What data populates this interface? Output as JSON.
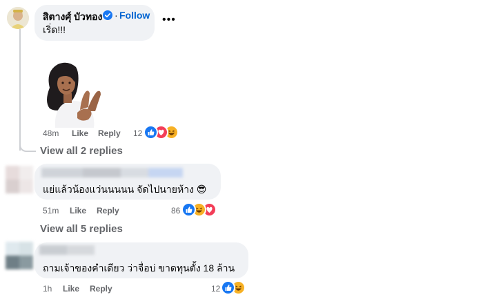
{
  "comment1": {
    "author": "สิตางศุ์ บัวทอง",
    "verified": true,
    "follow_label": "Follow",
    "text": "เริ่ด!!!",
    "more_icon": "more-options-icon",
    "time": "48m",
    "like_label": "Like",
    "reply_label": "Reply",
    "reaction_count": "12",
    "reactions": [
      "like",
      "love",
      "haha"
    ],
    "view_replies": "View all 2 replies"
  },
  "comment2": {
    "author_blurred": true,
    "text": "แย่แล้วน้องแว่นนนนน จัดไปนายห้าง 😎",
    "time": "51m",
    "like_label": "Like",
    "reply_label": "Reply",
    "reaction_count": "86",
    "reactions": [
      "like",
      "haha",
      "love"
    ],
    "view_replies": "View all 5 replies"
  },
  "comment3": {
    "author_blurred": true,
    "text": "ถามเจ้าของคำเดียว ว่าจื่อบ่ ขาดทุนตั้ง 18 ล้าน",
    "time": "1h",
    "like_label": "Like",
    "reply_label": "Reply",
    "reaction_count": "12",
    "reactions": [
      "like",
      "haha"
    ]
  },
  "colors": {
    "bubble": "#f0f2f5",
    "meta": "#65676b",
    "link": "#0064d1",
    "like": "#1877f2",
    "love": "#f33e58",
    "haha": "#f7b125"
  }
}
